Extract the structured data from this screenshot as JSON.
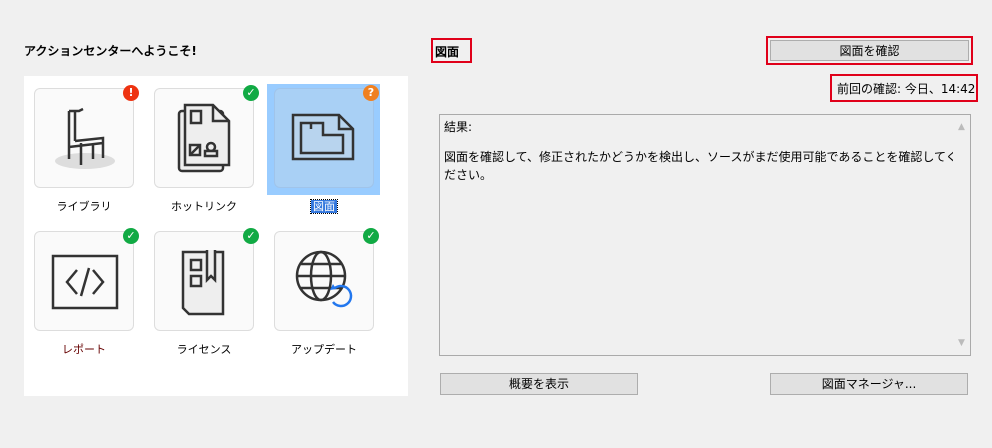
{
  "welcome": "アクションセンターへようこそ!",
  "tiles": [
    {
      "label": "ライブラリ",
      "icon": "chair-icon",
      "status": "error",
      "badge": "!"
    },
    {
      "label": "ホットリンク",
      "icon": "hotlink-document-icon",
      "status": "ok",
      "badge": "✓"
    },
    {
      "label": "図面",
      "icon": "drawing-icon",
      "status": "unknown",
      "badge": "?",
      "selected": true
    },
    {
      "label": "レポート",
      "icon": "code-report-icon",
      "status": "ok",
      "badge": "✓"
    },
    {
      "label": "ライセンス",
      "icon": "license-icon",
      "status": "ok",
      "badge": "✓"
    },
    {
      "label": "アップデート",
      "icon": "globe-update-icon",
      "status": "ok",
      "badge": "✓"
    }
  ],
  "detail": {
    "title": "図面",
    "check_button": "図面を確認",
    "last_check": "前回の確認: 今日、14:42",
    "results_label": "結果:",
    "results_text": "図面を確認して、修正されたかどうかを検出し、ソースがまだ使用可能であることを確認してください。",
    "summary_button": "概要を表示",
    "manager_button": "図面マネージャ..."
  },
  "colors": {
    "error": "#ee3311",
    "ok": "#11aa44",
    "unknown": "#f08020",
    "selection": "#99ccff"
  }
}
